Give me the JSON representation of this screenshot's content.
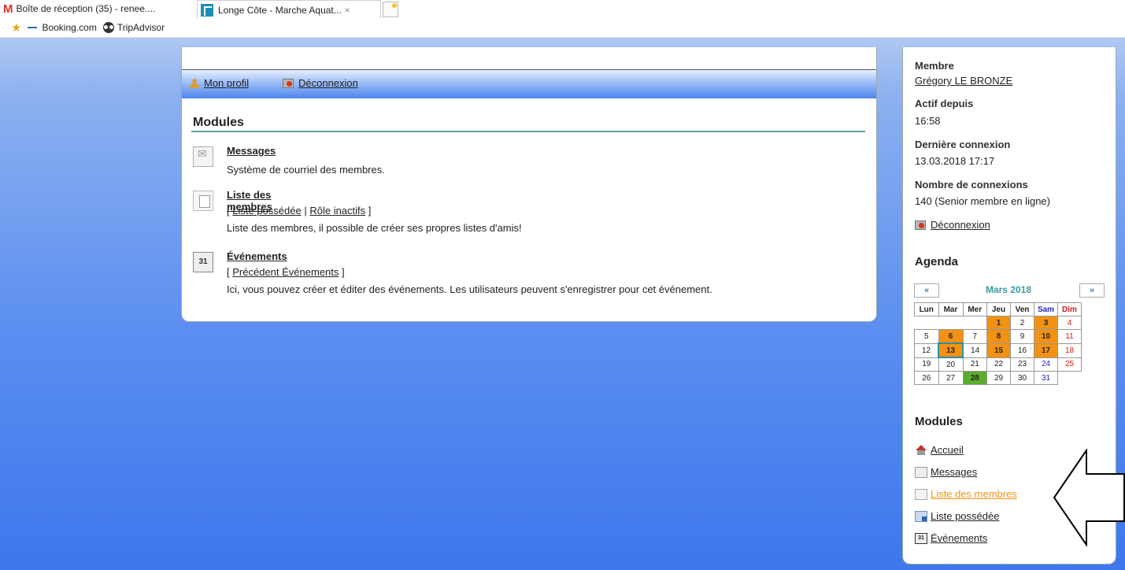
{
  "browser": {
    "tabs": [
      {
        "label": "Boîte de réception (35) - renee...."
      },
      {
        "label": "Longe Côte - Marche Aquat...",
        "close": "×"
      }
    ],
    "bookmarks": [
      {
        "label": "Booking.com"
      },
      {
        "label": "TripAdvisor"
      }
    ]
  },
  "profilebar": {
    "profile_label": "Mon profil",
    "logout_label": "Déconnexion"
  },
  "main": {
    "title": "Modules",
    "modules": [
      {
        "title": "Messages",
        "description": "Système de courriel des membres."
      },
      {
        "title": "Liste des membres",
        "links_prefix": "[",
        "link1": "Liste possédée",
        "sep": "|",
        "link2": "Rôle inactifs",
        "links_suffix": "]",
        "description": "Liste des membres, il possible de créer ses propres listes d'amis!"
      },
      {
        "title": "Événements",
        "icon_text": "31",
        "links_prefix": "[",
        "link1": "Précédent Événements",
        "links_suffix": "]",
        "description": "Ici, vous pouvez créer et éditer des événements. Les utilisateurs peuvent s'enregistrer pour cet événement."
      }
    ]
  },
  "sidebar": {
    "member_label": "Membre",
    "member_name": "Grégory LE BRONZE",
    "active_label": "Actif depuis",
    "active_value": "16:58",
    "last_login_label": "Dernière connexion",
    "last_login_value": "13.03.2018 17:17",
    "login_count_label": "Nombre de connexions",
    "login_count_value": "140 (Senior membre en ligne)",
    "logout_label": "Déconnexion",
    "agenda_title": "Agenda",
    "calendar": {
      "prev": "«",
      "next": "»",
      "month": "Mars 2018",
      "weekdays": [
        "Lun",
        "Mar",
        "Mer",
        "Jeu",
        "Ven",
        "Sam",
        "Dim"
      ],
      "event_days": [
        1,
        3,
        6,
        8,
        10,
        13,
        15,
        17
      ],
      "highlight_day": 28,
      "today": 13
    },
    "modules_title": "Modules",
    "modules": [
      {
        "label": "Accueil"
      },
      {
        "label": "Messages"
      },
      {
        "label": "Liste des membres"
      },
      {
        "label": "Liste possédée"
      },
      {
        "label": "Événements",
        "icon_text": "31"
      }
    ]
  },
  "colors": {
    "event_day": "#f39212",
    "highlight_day": "#5aad2c",
    "active_link": "#f39212",
    "accent_rule": "#5aa0a0"
  }
}
